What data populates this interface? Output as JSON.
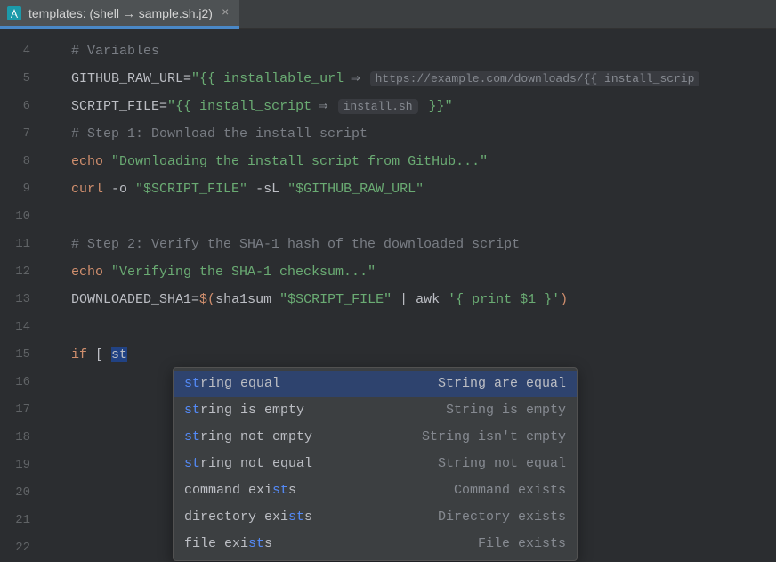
{
  "tab": {
    "title": "templates: (shell → sample.sh.j2)",
    "close": "×"
  },
  "gutter_start": 4,
  "gutter_end": 22,
  "code": {
    "l4": {
      "comment": "# Variables"
    },
    "l5": {
      "var": "GITHUB_RAW_URL",
      "eq": "=",
      "q1": "\"",
      "tpl1": "{{ installable_url",
      "hint_arrow": " ⇒ ",
      "hint": "https://example.com/downloads/{{ install_scrip"
    },
    "l6": {
      "var": "SCRIPT_FILE",
      "eq": "=",
      "q1": "\"",
      "tpl1": "{{ install_script",
      "hint_arrow": " ⇒ ",
      "hint": "install.sh",
      "tpl2": " }}",
      "q2": "\""
    },
    "l7": {
      "comment": "# Step 1: Download the install script"
    },
    "l8": {
      "cmd": "echo",
      "str": " \"Downloading the install script from GitHub...\""
    },
    "l9": {
      "cmd": "curl",
      "o1": " -o",
      "s1": " \"$SCRIPT_FILE\"",
      "o2": " -sL",
      "s2": " \"$GITHUB_RAW_URL\""
    },
    "l11": {
      "comment": "# Step 2: Verify the SHA-1 hash of the downloaded script"
    },
    "l12": {
      "cmd": "echo",
      "str": " \"Verifying the SHA-1 checksum...\""
    },
    "l13": {
      "var": "DOWNLOADED_SHA1",
      "eq": "=",
      "subopen": "$(",
      "fn1": "sha1sum",
      "s1": " \"$SCRIPT_FILE\"",
      "pipe": " | ",
      "fn2": "awk",
      "s2": " '{ print $1 }'",
      "subclose": ")"
    },
    "l15": {
      "kw": "if",
      "bracket": " [ ",
      "partial": "st"
    }
  },
  "autocomplete": {
    "items": [
      {
        "pre": "st",
        "rest": "ring equal",
        "desc": "String are equal",
        "selected": true,
        "hl": "prefix"
      },
      {
        "pre": "st",
        "rest": "ring is empty",
        "desc": "String is empty",
        "selected": false,
        "hl": "prefix"
      },
      {
        "pre": "st",
        "rest": "ring not empty",
        "desc": "String isn't empty",
        "selected": false,
        "hl": "prefix"
      },
      {
        "pre": "st",
        "rest": "ring not equal",
        "desc": "String not equal",
        "selected": false,
        "hl": "prefix"
      },
      {
        "pre": "command exi",
        "mid": "st",
        "rest": "s",
        "desc": "Command exists",
        "selected": false,
        "hl": "mid"
      },
      {
        "pre": "directory exi",
        "mid": "st",
        "rest": "s",
        "desc": "Directory exists",
        "selected": false,
        "hl": "mid"
      },
      {
        "pre": "file exi",
        "mid": "st",
        "rest": "s",
        "desc": "File exists",
        "selected": false,
        "hl": "mid"
      }
    ]
  }
}
